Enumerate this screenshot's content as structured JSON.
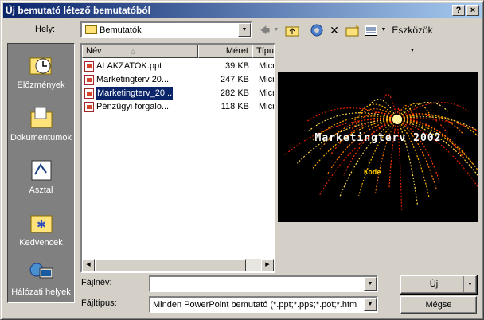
{
  "window": {
    "title": "Új bemutató létező bemutatóból",
    "help_label": "?",
    "close_label": "×"
  },
  "lookin": {
    "label": "Hely:",
    "value": "Bemutatók"
  },
  "toolbar": {
    "tools_label": "Eszközök"
  },
  "places": [
    {
      "label": "Előzmények",
      "icon": "history-icon"
    },
    {
      "label": "Dokumentumok",
      "icon": "my-documents-icon"
    },
    {
      "label": "Asztal",
      "icon": "desktop-icon"
    },
    {
      "label": "Kedvencek",
      "icon": "favorites-icon"
    },
    {
      "label": "Hálózati helyek",
      "icon": "network-places-icon"
    }
  ],
  "filelist": {
    "columns": {
      "name": "Név",
      "size": "Méret",
      "type": "Típus"
    },
    "rows": [
      {
        "name": "ALAKZATOK.ppt",
        "size": "39 KB",
        "type": "Micro"
      },
      {
        "name": "Marketingterv 20...",
        "size": "247 KB",
        "type": "Micro"
      },
      {
        "name": "Marketingterv_20...",
        "size": "282 KB",
        "type": "Micro",
        "selected": true
      },
      {
        "name": "Pénzügyi forgalo...",
        "size": "118 KB",
        "type": "Micro"
      }
    ]
  },
  "preview": {
    "title": "Marketingterv 2002",
    "subtitle": "Kode"
  },
  "filename": {
    "label": "Fájlnév:",
    "value": ""
  },
  "filetype": {
    "label": "Fájltípus:",
    "value": "Minden PowerPoint bemutató (*.ppt;*.pps;*.pot;*.htm"
  },
  "buttons": {
    "new": "Új",
    "cancel": "Mégse"
  }
}
